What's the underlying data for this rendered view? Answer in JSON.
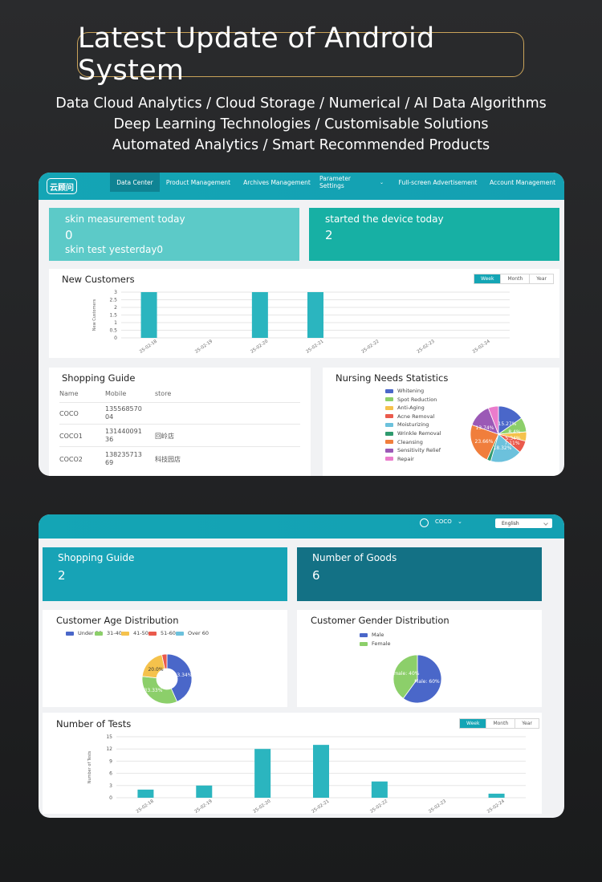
{
  "hero": {
    "title": "Latest Update of Android System",
    "line1": "Data Cloud Analytics / Cloud Storage / Numerical /  AI Data Algorithms",
    "line2": "Deep Learning Technologies / Customisable Solutions",
    "line3": "Automated Analytics / Smart Recommended Products"
  },
  "panel1": {
    "logo": "云顾问",
    "nav": [
      "Data Center",
      "Product Management",
      "Archives Management",
      "Parameter Settings",
      "Full-screen Advertisement",
      "Account Management"
    ],
    "nav_active": "Data Center",
    "stat_left": {
      "label": "skin measurement today",
      "value": "0",
      "sub": "skin test yesterday0",
      "color": "#5ccac8"
    },
    "stat_right": {
      "label": "started the device today",
      "value": "2",
      "color": "#17b0a4"
    },
    "new_customers": {
      "title": "New Customers",
      "periods": [
        "Week",
        "Month",
        "Year"
      ],
      "active_period": "Week"
    },
    "shopping_guide": {
      "title": "Shopping Guide",
      "columns": [
        "Name",
        "Mobile",
        "store"
      ],
      "rows": [
        [
          "COCO",
          "135568570\n04",
          ""
        ],
        [
          "COCO1",
          "131440091\n36",
          "回岭店"
        ],
        [
          "COCO2",
          "138235713\n69",
          "科技园店"
        ]
      ]
    },
    "nursing": {
      "title": "Nursing Needs Statistics",
      "legend": [
        {
          "name": "Whitening",
          "color": "#4a67c9"
        },
        {
          "name": "Spot Reduction",
          "color": "#8ccf6a"
        },
        {
          "name": "Anti-Aging",
          "color": "#f5c24c"
        },
        {
          "name": "Acne Removal",
          "color": "#ea5a4c"
        },
        {
          "name": "Moisturizing",
          "color": "#6cc1dc"
        },
        {
          "name": "Wrinkle Removal",
          "color": "#2f9a6e"
        },
        {
          "name": "Cleansing",
          "color": "#f07e3c"
        },
        {
          "name": "Sensitivity Relief",
          "color": "#9b59b6"
        },
        {
          "name": "Repair",
          "color": "#ea7ccc"
        }
      ],
      "labels": [
        "15.27%",
        "8.4%",
        "5.34%",
        "7.11%",
        "18.32%",
        "23.66%",
        "13.74%"
      ]
    }
  },
  "panel2": {
    "user": "COCO",
    "language": "English",
    "stat_left": {
      "label": "Shopping Guide",
      "value": "2",
      "color": "#17a3b6"
    },
    "stat_right": {
      "label": "Number of Goods",
      "value": "6",
      "color": "#137185"
    },
    "age": {
      "title": "Customer Age Distribution",
      "legend": [
        {
          "name": "Under 30",
          "color": "#4a67c9"
        },
        {
          "name": "31-40",
          "color": "#8ccf6a"
        },
        {
          "name": "41-50",
          "color": "#f5c24c"
        },
        {
          "name": "51-60",
          "color": "#ea5a4c"
        },
        {
          "name": "Over 60",
          "color": "#6cc1dc"
        }
      ],
      "labels": [
        "43.34%",
        "33.33%",
        "20.0%"
      ]
    },
    "gender": {
      "title": "Customer Gender Distribution",
      "legend": [
        {
          "name": "Male",
          "color": "#4a67c9"
        },
        {
          "name": "Female",
          "color": "#8ccf6a"
        }
      ],
      "labels": [
        "Male: 60%",
        "Female: 40%"
      ]
    },
    "tests": {
      "title": "Number of Tests",
      "periods": [
        "Week",
        "Month",
        "Year"
      ],
      "active_period": "Week"
    }
  },
  "chart_data": [
    {
      "type": "bar",
      "title": "New Customers",
      "ylabel": "New Customers",
      "categories": [
        "25-02-18",
        "25-02-19",
        "25-02-20",
        "25-02-21",
        "25-02-22",
        "25-02-23",
        "25-02-24"
      ],
      "values": [
        3,
        0,
        3,
        3,
        0,
        0,
        0
      ],
      "yticks": [
        "0",
        "0.5",
        "1",
        "1.5",
        "2",
        "2.5",
        "3"
      ],
      "ylim": [
        0,
        3
      ],
      "color": "#2bb5bf",
      "grid": true
    },
    {
      "type": "pie",
      "title": "Nursing Needs Statistics",
      "categories": [
        "Whitening",
        "Spot Reduction",
        "Anti-Aging",
        "Acne Removal",
        "Moisturizing",
        "Wrinkle Removal",
        "Cleansing",
        "Sensitivity Relief",
        "Repair"
      ],
      "values": [
        15.27,
        8.4,
        5.34,
        7.11,
        18.32,
        2.29,
        23.66,
        13.74,
        5.87
      ]
    },
    {
      "type": "pie",
      "title": "Customer Age Distribution",
      "categories": [
        "Under 30",
        "31-40",
        "41-50",
        "51-60",
        "Over 60"
      ],
      "values": [
        43.34,
        33.33,
        20.0,
        3.33,
        0
      ]
    },
    {
      "type": "pie",
      "title": "Customer Gender Distribution",
      "categories": [
        "Male",
        "Female"
      ],
      "values": [
        60,
        40
      ]
    },
    {
      "type": "bar",
      "title": "Number of Tests",
      "ylabel": "Number of Tests",
      "categories": [
        "25-02-18",
        "25-02-19",
        "25-02-20",
        "25-02-21",
        "25-02-22",
        "25-02-23",
        "25-02-24"
      ],
      "values": [
        2,
        3,
        12,
        13,
        4,
        0,
        1
      ],
      "yticks": [
        "0",
        "3",
        "6",
        "9",
        "12",
        "15"
      ],
      "ylim": [
        0,
        15
      ],
      "color": "#2bb5bf",
      "grid": true
    }
  ]
}
